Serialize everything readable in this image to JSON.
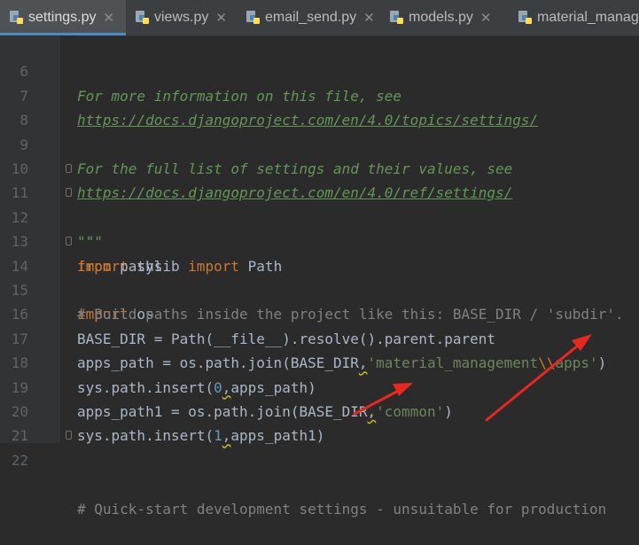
{
  "tabs": [
    {
      "label": "settings.py",
      "active": true
    },
    {
      "label": "views.py",
      "active": false
    },
    {
      "label": "email_send.py",
      "active": false
    },
    {
      "label": "models.py",
      "active": false
    },
    {
      "label": "material_managem",
      "active": false
    }
  ],
  "lines": {
    "6": {
      "num": "6",
      "text": "For more information on this file, see"
    },
    "7": {
      "num": "7",
      "text": "https://docs.djangoproject.com/en/4.0/topics/settings/"
    },
    "8": {
      "num": "8"
    },
    "9": {
      "num": "9",
      "text": "For the full list of settings and their values, see"
    },
    "10": {
      "num": "10",
      "text": "https://docs.djangoproject.com/en/4.0/ref/settings/"
    },
    "11": {
      "num": "11",
      "text": "\"\"\""
    },
    "12": {
      "num": "12",
      "kw": "import",
      "rest": " sys"
    },
    "13": {
      "num": "13",
      "kw1": "from",
      "mid": " pathlib ",
      "kw2": "import",
      "rest": " Path"
    },
    "14": {
      "num": "14",
      "kw": "import",
      "rest": " os"
    },
    "15": {
      "num": "15",
      "text": "# Build paths inside the project like this: BASE_DIR / 'subdir'."
    },
    "16": {
      "num": "16",
      "text": "BASE_DIR = Path(__file__).resolve().parent.parent"
    },
    "17": {
      "num": "17",
      "pre": "apps_path = os.path.join(BASE_DIR",
      "comma": ",",
      "str1": "'material_management",
      "esc": "\\\\",
      "str2": "apps'",
      "post": ")"
    },
    "18": {
      "num": "18",
      "pre": "sys.path.insert(",
      "n": "0",
      "comma": ",",
      "post": "apps_path)"
    },
    "19": {
      "num": "19",
      "pre": "apps_path1 = os.path.join(BASE_DIR",
      "comma": ",",
      "str": "'common'",
      "post": ")"
    },
    "20": {
      "num": "20",
      "pre": "sys.path.insert(",
      "n": "1",
      "comma": ",",
      "post": "apps_path1)"
    },
    "21": {
      "num": "21"
    },
    "22": {
      "num": "22",
      "text": "# Quick-start development settings - unsuitable for production"
    }
  },
  "colors": {
    "background": "#2b2b2b",
    "keyword": "#cc7832",
    "string": "#6a8759",
    "docstring": "#629755",
    "comment": "#808080",
    "number": "#6897bb",
    "arrow": "#e8281e"
  },
  "icons": {
    "tab": "python-file-icon",
    "annotation": "red-arrow"
  }
}
